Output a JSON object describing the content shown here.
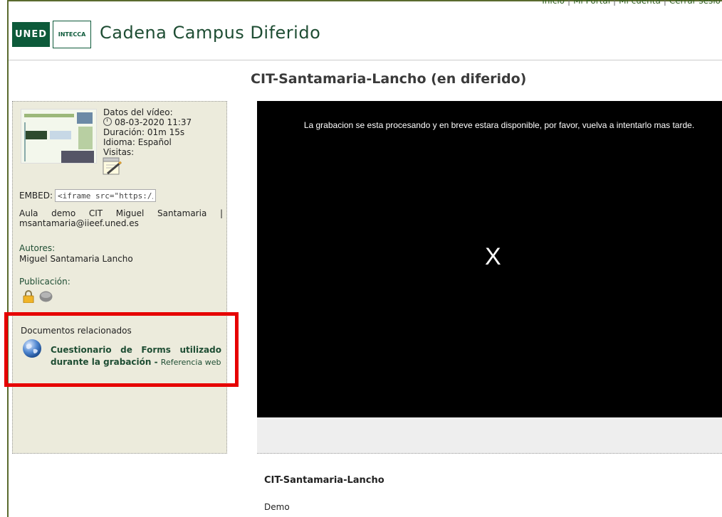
{
  "header": {
    "nav": [
      "Inicio",
      "Mi Portal",
      "Mi cuenta",
      "Cerrar sesió"
    ],
    "logo_uned": "UNED",
    "logo_intecca": "INTECCA",
    "site_title": "Cadena Campus Diferido"
  },
  "page_title": "CIT-Santamaria-Lancho (en diferido)",
  "sidebar": {
    "datos_label": "Datos del vídeo:",
    "fecha": "08-03-2020 11:37",
    "duracion": "Duración: 01m 15s",
    "idioma": "Idioma: Español",
    "visitas": "Visitas:",
    "embed_label": "EMBED:",
    "embed_value": "<iframe src=\"https://www",
    "aula": "Aula demo CIT Miguel Santamaria | msantamaria@iieef.uned.es",
    "autores_label": "Autores:",
    "autores_value": "Miguel Santamaria Lancho",
    "publicacion_label": "Publicación:",
    "docs_label": "Documentos relacionados",
    "doc_link": "Cuestionario de Forms utilizado durante la grabación",
    "doc_sep": " - ",
    "doc_ref": "Referencia web"
  },
  "video": {
    "message": "La grabacion se esta procesando y en breve estara disponible, por favor, vuelva a intentarlo mas tarde.",
    "close_glyph": "X",
    "title": "CIT-Santamaria-Lancho",
    "description": "Demo"
  },
  "colors": {
    "brand_green": "#0d5a3a",
    "highlight": "#e60000",
    "sidebar_bg": "#ecebdc"
  }
}
